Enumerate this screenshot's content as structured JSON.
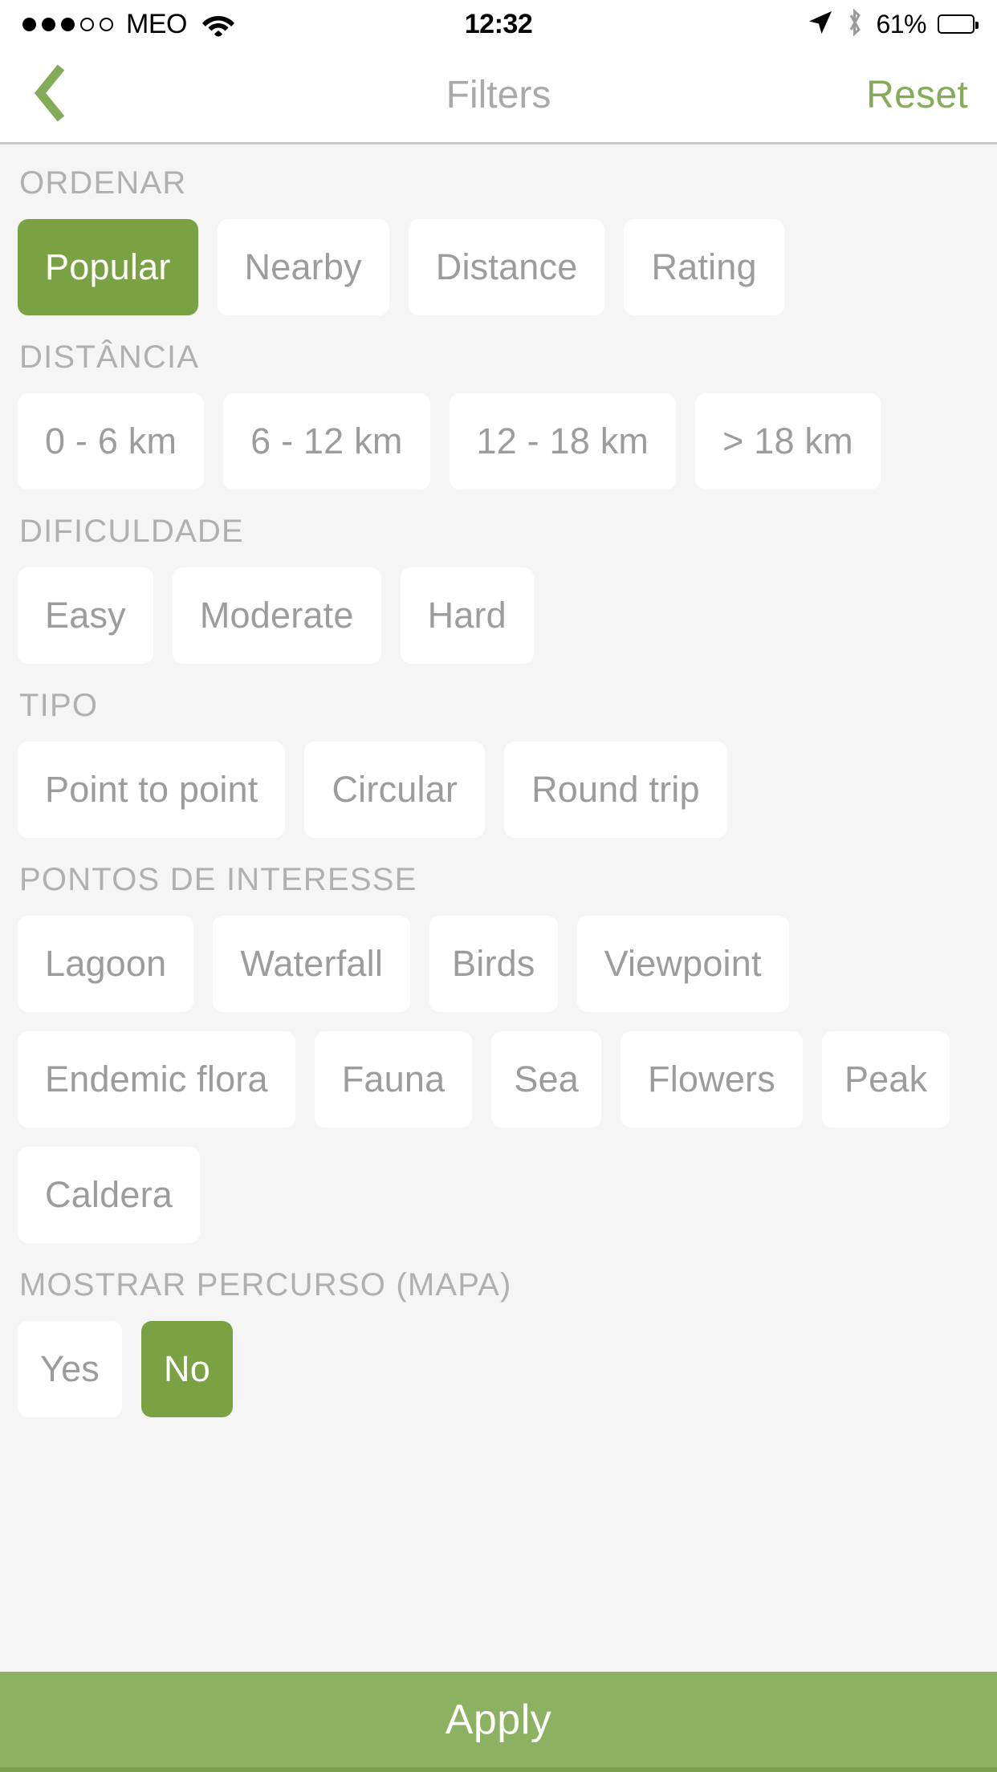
{
  "status_bar": {
    "carrier": "MEO",
    "signal_dots_filled": 3,
    "signal_dots_total": 5,
    "wifi_icon": "wifi-icon",
    "time": "12:32",
    "location_icon": "location-arrow-icon",
    "bluetooth_icon": "bluetooth-icon",
    "battery_percent": "61%",
    "battery_level": 61
  },
  "nav_bar": {
    "back_icon": "chevron-left-icon",
    "title": "Filters",
    "reset_label": "Reset",
    "accent_color": "#84ab55",
    "title_color": "#a9a9a9"
  },
  "theme": {
    "background": "#f5f5f5",
    "chip_background": "#ffffff",
    "chip_text": "#9c9c9c",
    "chip_selected_background": "#7ba242",
    "chip_selected_text": "#ffffff",
    "section_title_color": "#b0b0b0",
    "apply_background": "#8bb161"
  },
  "sections": [
    {
      "key": "ordenar",
      "title": "ORDENAR",
      "options": [
        {
          "label": "Popular",
          "selected": true
        },
        {
          "label": "Nearby",
          "selected": false
        },
        {
          "label": "Distance",
          "selected": false
        },
        {
          "label": "Rating",
          "selected": false
        }
      ]
    },
    {
      "key": "distancia",
      "title": "DISTÂNCIA",
      "options": [
        {
          "label": "0 - 6 km",
          "selected": false
        },
        {
          "label": "6 - 12 km",
          "selected": false
        },
        {
          "label": "12 - 18 km",
          "selected": false
        },
        {
          "label": "> 18 km",
          "selected": false
        }
      ]
    },
    {
      "key": "dificuldade",
      "title": "DIFICULDADE",
      "options": [
        {
          "label": "Easy",
          "selected": false
        },
        {
          "label": "Moderate",
          "selected": false
        },
        {
          "label": "Hard",
          "selected": false
        }
      ]
    },
    {
      "key": "tipo",
      "title": "TIPO",
      "options": [
        {
          "label": "Point to point",
          "selected": false
        },
        {
          "label": "Circular",
          "selected": false
        },
        {
          "label": "Round trip",
          "selected": false
        }
      ]
    },
    {
      "key": "pontos_de_interesse",
      "title": "PONTOS DE INTERESSE",
      "options": [
        {
          "label": "Lagoon",
          "selected": false
        },
        {
          "label": "Waterfall",
          "selected": false
        },
        {
          "label": "Birds",
          "selected": false
        },
        {
          "label": "Viewpoint",
          "selected": false
        },
        {
          "label": "Endemic flora",
          "selected": false
        },
        {
          "label": "Fauna",
          "selected": false
        },
        {
          "label": "Sea",
          "selected": false
        },
        {
          "label": "Flowers",
          "selected": false
        },
        {
          "label": "Peak",
          "selected": false
        },
        {
          "label": "Caldera",
          "selected": false
        }
      ]
    },
    {
      "key": "mostrar_percurso",
      "title": "MOSTRAR PERCURSO (MAPA)",
      "options": [
        {
          "label": "Yes",
          "selected": false
        },
        {
          "label": "No",
          "selected": true
        }
      ]
    }
  ],
  "apply": {
    "label": "Apply"
  }
}
